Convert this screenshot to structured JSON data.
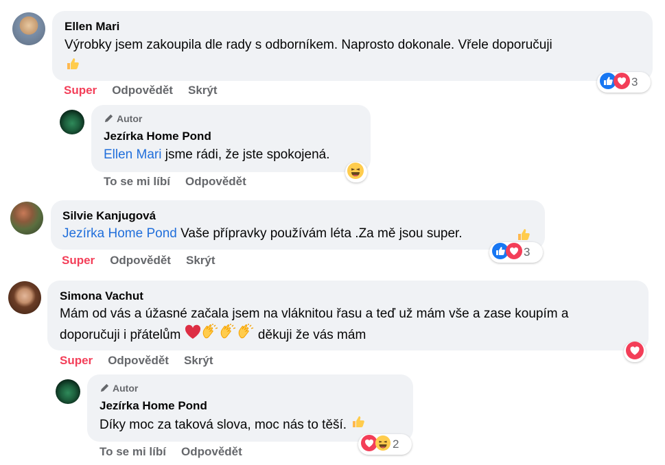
{
  "comments": [
    {
      "name": "Ellen Mari",
      "text_line1": "Výrobky jsem zakoupila dle rady s odborníkem. Naprosto dokonale. Vřele doporučuji",
      "actions": {
        "super": "Super",
        "reply": "Odpovědět",
        "hide": "Skrýt"
      },
      "reaction_count": "3",
      "reactions": [
        "like-icon",
        "love-icon"
      ]
    },
    {
      "author_badge": "Autor",
      "name": "Jezírka Home Pond",
      "mention": "Ellen Mari",
      "text": " jsme rádi, že jste spokojená.",
      "actions": {
        "like": "To se mi líbí",
        "reply": "Odpovědět"
      },
      "reactions": [
        "haha-icon"
      ]
    },
    {
      "name": "Silvie Kanjugová",
      "mention": "Jezírka Home Pond",
      "text": " Vaše přípravky používám léta .Za mě jsou super.",
      "actions": {
        "super": "Super",
        "reply": "Odpovědět",
        "hide": "Skrýt"
      },
      "reaction_count": "3",
      "reactions": [
        "like-icon",
        "love-icon"
      ]
    },
    {
      "name": "Simona Vachut",
      "text_line1": "Mám od vás a úžasné začala jsem na vláknitou řasu a teď už mám vše a zase koupím a",
      "text_line2a": "doporučuji i přátelům",
      "text_line2b": " děkuji že vás mám",
      "actions": {
        "super": "Super",
        "reply": "Odpovědět",
        "hide": "Skrýt"
      },
      "reactions": [
        "love-icon"
      ]
    },
    {
      "author_badge": "Autor",
      "name": "Jezírka Home Pond",
      "text": "Díky moc za taková slova, moc nás to těší.",
      "actions": {
        "like": "To se mi líbí",
        "reply": "Odpovědět"
      },
      "reaction_count": "2",
      "reactions": [
        "love-icon",
        "haha-icon"
      ]
    }
  ],
  "colors": {
    "bubble": "#f0f2f5",
    "mention": "#216fdb",
    "super": "#f33e58",
    "meta": "#65676b"
  }
}
